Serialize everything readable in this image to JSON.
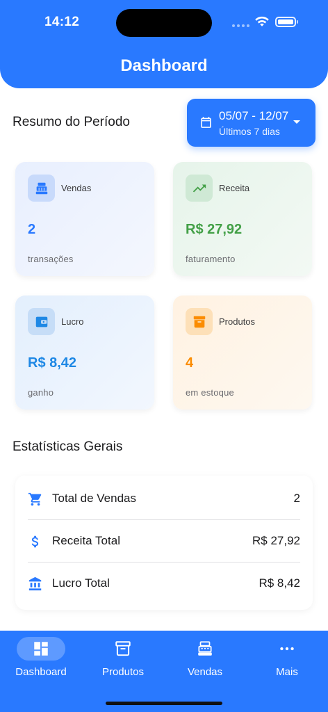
{
  "status_bar": {
    "time": "14:12"
  },
  "header": {
    "title": "Dashboard"
  },
  "period": {
    "title": "Resumo do Período",
    "date_range": "05/07 - 12/07",
    "date_sub": "Últimos 7 dias"
  },
  "cards": {
    "vendas": {
      "label": "Vendas",
      "value": "2",
      "sub": "transações",
      "icon": "cash-register-icon",
      "color": "#2979ff"
    },
    "receita": {
      "label": "Receita",
      "value": "R$ 27,92",
      "sub": "faturamento",
      "icon": "trending-up-icon",
      "color": "#43a047"
    },
    "lucro": {
      "label": "Lucro",
      "value": "R$ 8,42",
      "sub": "ganho",
      "icon": "wallet-icon",
      "color": "#1e88e5"
    },
    "produtos": {
      "label": "Produtos",
      "value": "4",
      "sub": "em estoque",
      "icon": "archive-icon",
      "color": "#fb8c00"
    }
  },
  "stats": {
    "title": "Estatísticas Gerais",
    "rows": [
      {
        "label": "Total de Vendas",
        "value": "2",
        "icon": "cart-icon"
      },
      {
        "label": "Receita Total",
        "value": "R$ 27,92",
        "icon": "dollar-icon"
      },
      {
        "label": "Lucro Total",
        "value": "R$ 8,42",
        "icon": "bank-icon"
      }
    ]
  },
  "nav": {
    "items": [
      {
        "label": "Dashboard",
        "icon": "dashboard-icon",
        "active": true
      },
      {
        "label": "Produtos",
        "icon": "archive-icon",
        "active": false
      },
      {
        "label": "Vendas",
        "icon": "cash-register-icon",
        "active": false
      },
      {
        "label": "Mais",
        "icon": "more-icon",
        "active": false
      }
    ]
  },
  "colors": {
    "primary": "#2979ff",
    "success": "#43a047",
    "warning": "#fb8c00"
  }
}
